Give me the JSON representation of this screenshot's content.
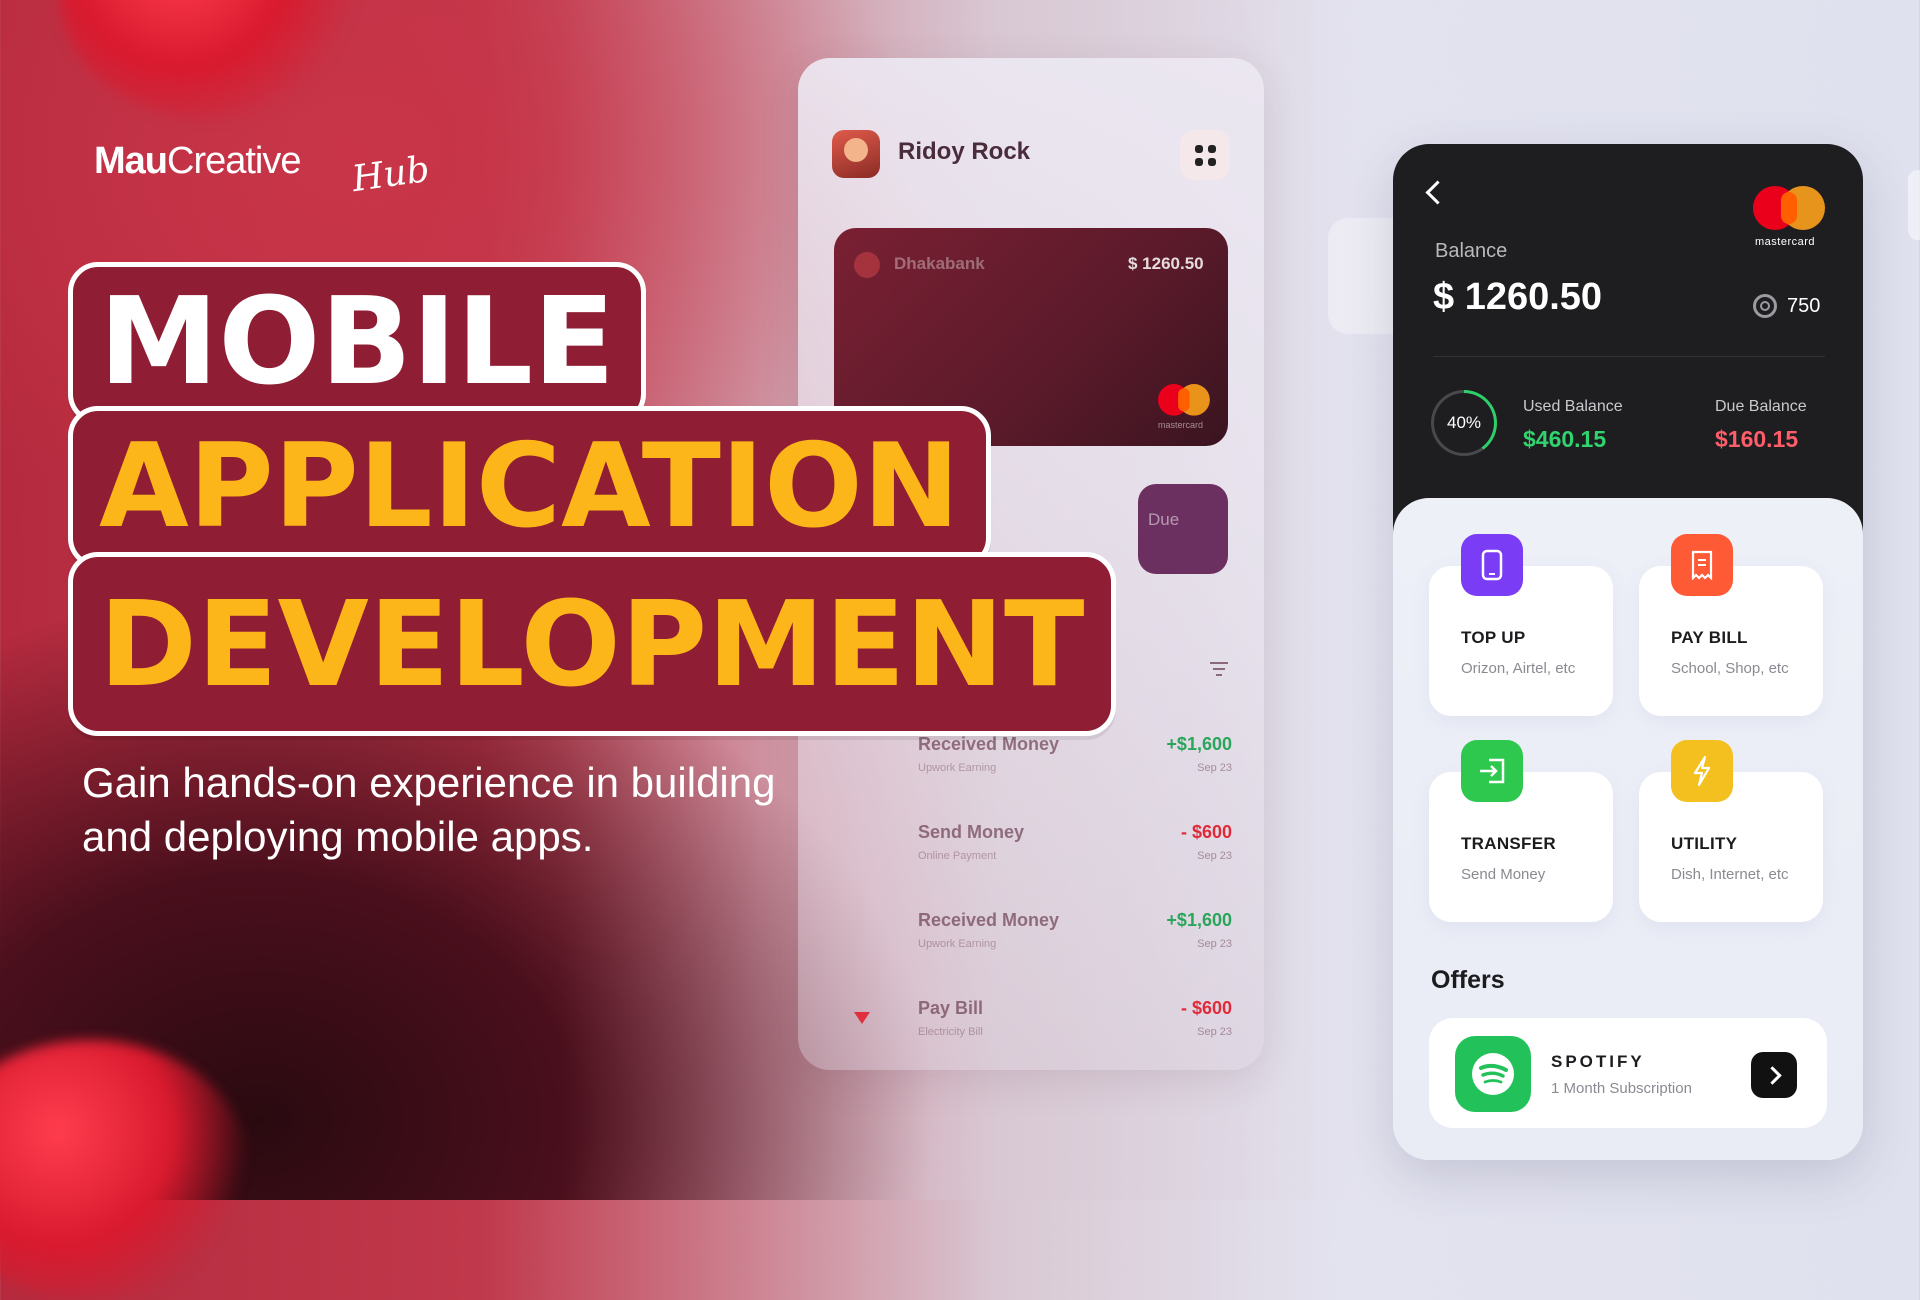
{
  "brand": {
    "logo_main_a": "Mau",
    "logo_main_b": "Creative",
    "logo_script": "Hub"
  },
  "headline": {
    "line1": "MOBILE",
    "line2": "APPLICATION",
    "line3": "DEVELOPMENT"
  },
  "subtitle": "Gain hands-on experience in building and deploying mobile apps.",
  "mid_phone": {
    "user_name": "Ridoy Rock",
    "card": {
      "bank": "Dhakabank",
      "balance": "$ 1260.50",
      "network": "mastercard"
    },
    "due_partial": "Due",
    "transactions": [
      {
        "title": "Received Money",
        "sub": "Upwork Earning",
        "amount": "+$1,600",
        "date": "Sep 23",
        "kind": "pos"
      },
      {
        "title": "Send Money",
        "sub": "Online Payment",
        "amount": "- $600",
        "date": "Sep 23",
        "kind": "neg"
      },
      {
        "title": "Received Money",
        "sub": "Upwork Earning",
        "amount": "+$1,600",
        "date": "Sep 23",
        "kind": "pos"
      },
      {
        "title": "Pay Bill",
        "sub": "Electricity Bill",
        "amount": "- $600",
        "date": "Sep 23",
        "kind": "neg"
      }
    ]
  },
  "right_phone": {
    "network": "mastercard",
    "balance_label": "Balance",
    "balance_value": "$ 1260.50",
    "points": "750",
    "used_percent_label": "40%",
    "used_percent": 0.4,
    "used_label": "Used Balance",
    "used_value": "$460.15",
    "due_label": "Due Balance",
    "due_value": "$160.15",
    "services": [
      {
        "title": "TOP UP",
        "sub": "Orizon, Airtel, etc",
        "color": "#7b3cf5",
        "icon": "phone-icon"
      },
      {
        "title": "PAY BILL",
        "sub": "School, Shop, etc",
        "color": "#ff5a36",
        "icon": "receipt-icon"
      },
      {
        "title": "TRANSFER",
        "sub": "Send Money",
        "color": "#2fc84e",
        "icon": "transfer-icon"
      },
      {
        "title": "UTILITY",
        "sub": "Dish, Internet, etc",
        "color": "#f4c020",
        "icon": "lightning-icon"
      }
    ],
    "offers_title": "Offers",
    "offer": {
      "name": "SPOTIFY",
      "sub": "1 Month Subscription"
    }
  },
  "colors": {
    "headline_bg": "#8f1d33",
    "headline_accent": "#fdb61a",
    "positive": "#31d36e",
    "negative": "#ff5d6a"
  }
}
